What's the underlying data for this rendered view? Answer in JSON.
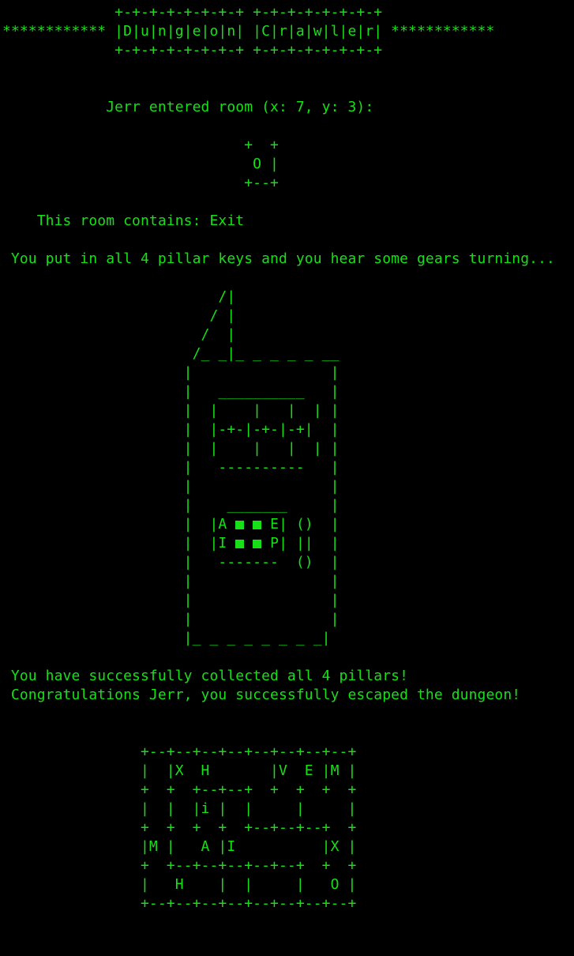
{
  "title_banner": {
    "line1": "             +-+-+-+-+-+-+-+ +-+-+-+-+-+-+-+",
    "line2": "************ |D|u|n|g|e|o|n| |C|r|a|w|l|e|r| ************",
    "line3": "             +-+-+-+-+-+-+-+ +-+-+-+-+-+-+-+"
  },
  "room_entry": {
    "message": "            Jerr entered room (x: 7, y: 3):",
    "room_ascii": [
      "                            +  +",
      "                             O |",
      "                            +--+"
    ],
    "contents": "    This room contains: Exit"
  },
  "pillar_message": " You put in all 4 pillar keys and you hear some gears turning...",
  "door_art": {
    "top": [
      "                         /|",
      "                        / |",
      "                       /  |",
      "                      /_ _|_ _ _ _ _ __",
      "                     |                |",
      "                     |   __________   |",
      "                     |  |    |   |  | |",
      "                     |  |-+-|-+-|-+|  |",
      "                     |  |    |   |  | |",
      "                     |   ----------   |",
      "                     |                |",
      "                     |    _______     |"
    ],
    "lock_row1_left": "                     |  |A ",
    "lock_row1_right": " E| ()  |",
    "lock_row2_left": "                     |  |I ",
    "lock_row2_right": " P| ||  |",
    "bottom": [
      "                     |   -------  ()  |",
      "                     |                |",
      "                     |                |",
      "                     |                |",
      "                     |_ _ _ _ _ _ _ _|"
    ],
    "pillar_symbol_color": "#16e016"
  },
  "victory": {
    "line1": " You have successfully collected all 4 pillars!",
    "line2": " Congratulations Jerr, you successfully escaped the dungeon!"
  },
  "dungeon_map": [
    "                +--+--+--+--+--+--+--+--+",
    "                |  |X  H       |V  E |M |",
    "                +  +  +--+--+  +  +  +  +",
    "                |  |  |i |  |     |     |",
    "                +  +  +  +  +--+--+--+  +",
    "                |M |   A |I          |X |",
    "                +  +--+--+--+--+--+  +  +",
    "                |   H    |  |     |   O |",
    "                +--+--+--+--+--+--+--+--+"
  ],
  "colors": {
    "background": "#000000",
    "text": "#16e016"
  }
}
